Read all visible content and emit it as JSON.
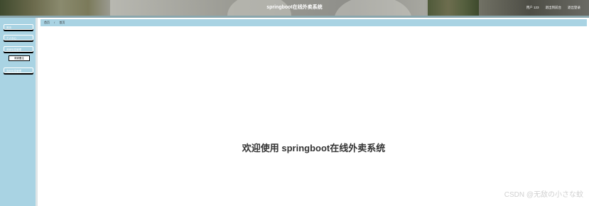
{
  "header": {
    "title": "springboot在线外卖系统",
    "user": "用户 123",
    "back_front": "退出到前台",
    "logout": "退出登录"
  },
  "sidebar": {
    "items": [
      {
        "label": "首页"
      },
      {
        "label": "个人中心"
      },
      {
        "label": "商家信息管理"
      },
      {
        "label": "商品信息管理"
      }
    ],
    "sub_item": {
      "label": "商家备注"
    }
  },
  "breadcrumb": {
    "home": "首页",
    "separator": "/",
    "current": "首页"
  },
  "main": {
    "welcome": "欢迎使用 springboot在线外卖系统"
  },
  "watermark": "CSDN @无敌の小さな蚊"
}
